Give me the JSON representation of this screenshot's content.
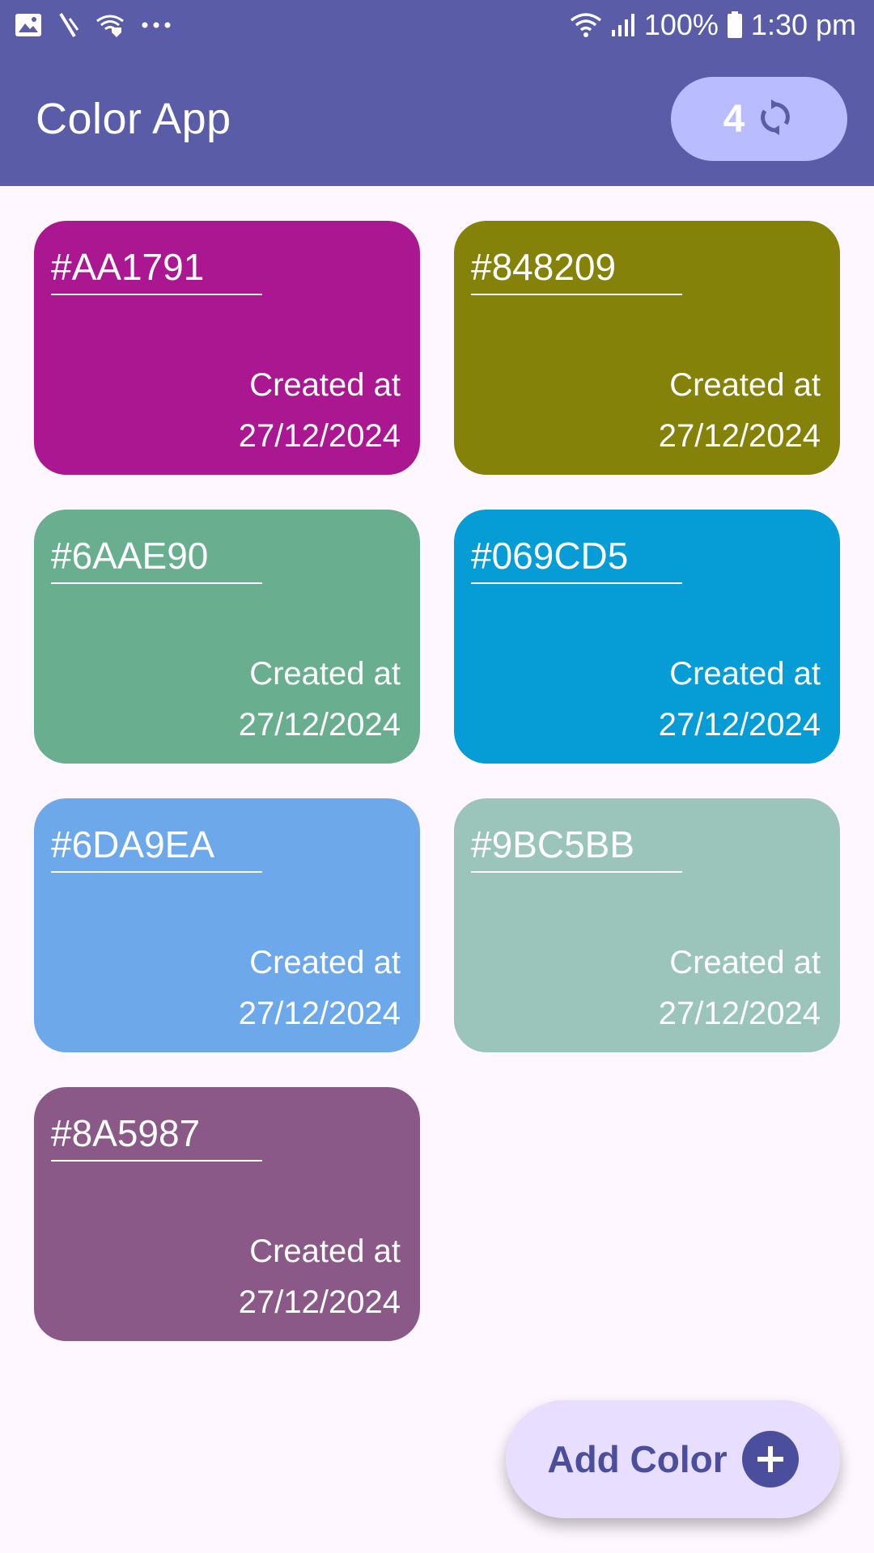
{
  "status_bar": {
    "battery_text": "100%",
    "time": "1:30 pm",
    "left_icons": [
      "image-icon",
      "signal-off-icon",
      "wifi-shield-icon",
      "more-dots-icon"
    ],
    "right_icons": [
      "wifi-icon",
      "signal-icon",
      "battery-icon"
    ]
  },
  "app_bar": {
    "title": "Color App",
    "counter": "4",
    "counter_icon": "sync-icon",
    "background": "#5A5CA8",
    "counter_background": "#B9BCFF"
  },
  "cards": [
    {
      "hex": "#AA1791",
      "created_label": "Created at",
      "created_date": "27/12/2024",
      "color": "#AA1791"
    },
    {
      "hex": "#848209",
      "created_label": "Created at",
      "created_date": "27/12/2024",
      "color": "#848209"
    },
    {
      "hex": "#6AAE90",
      "created_label": "Created at",
      "created_date": "27/12/2024",
      "color": "#6AAE90"
    },
    {
      "hex": "#069CD5",
      "created_label": "Created at",
      "created_date": "27/12/2024",
      "color": "#069CD5"
    },
    {
      "hex": "#6DA9EA",
      "created_label": "Created at",
      "created_date": "27/12/2024",
      "color": "#6DA9EA"
    },
    {
      "hex": "#9BC5BB",
      "created_label": "Created at",
      "created_date": "27/12/2024",
      "color": "#9BC5BB"
    },
    {
      "hex": "#8A5987",
      "created_label": "Created at",
      "created_date": "27/12/2024",
      "color": "#8A5987"
    }
  ],
  "fab": {
    "label": "Add Color",
    "icon": "plus-icon",
    "background": "#E8DEFF",
    "accent": "#4A4E9C"
  }
}
